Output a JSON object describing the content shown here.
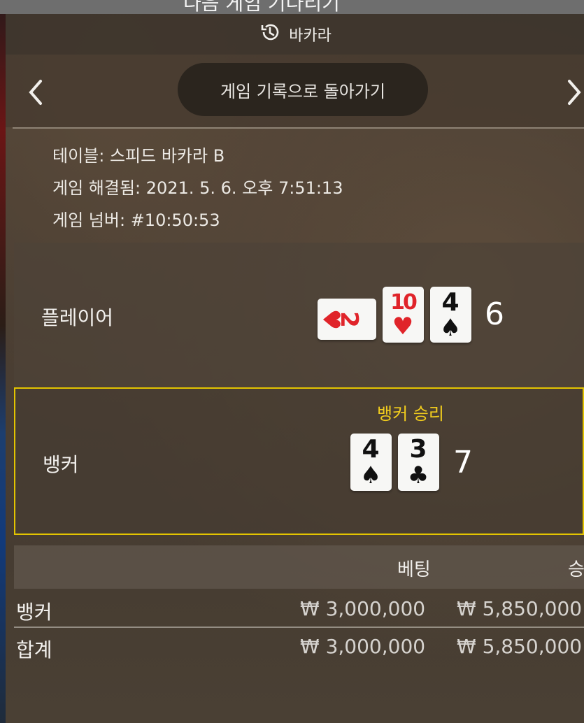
{
  "top_banner": {
    "text": "다음 게임 기다리기"
  },
  "header": {
    "title": "바카라",
    "icon": "history-icon"
  },
  "nav": {
    "back_label": "게임 기록으로 돌아가기",
    "prev_icon": "chevron-left-icon",
    "next_icon": "chevron-right-icon"
  },
  "info": {
    "table_label": "테이블:",
    "table_value": "스피드 바카라 B",
    "resolved_label": "게임 해결됨:",
    "resolved_value": "2021. 5. 6. 오후 7:51:13",
    "number_label": "게임 넘버:",
    "number_value": "#10:50:53"
  },
  "player": {
    "label": "플레이어",
    "cards": [
      {
        "rank": "2",
        "suit": "♥",
        "color": "#e0242a",
        "orientation": "sideways"
      },
      {
        "rank": "10",
        "suit": "♥",
        "color": "#e0242a",
        "orientation": "upright"
      },
      {
        "rank": "4",
        "suit": "♠",
        "color": "#111111",
        "orientation": "upright"
      }
    ],
    "score": "6"
  },
  "banker": {
    "label": "뱅커",
    "winner_text": "뱅커 승리",
    "winner_color": "#f2cd1d",
    "cards": [
      {
        "rank": "4",
        "suit": "♠",
        "color": "#111111",
        "orientation": "upright"
      },
      {
        "rank": "3",
        "suit": "♣",
        "color": "#111111",
        "orientation": "upright"
      }
    ],
    "score": "7"
  },
  "bets": {
    "headers": {
      "bet": "베팅",
      "win": "승"
    },
    "rows": [
      {
        "name": "뱅커",
        "bet": "₩ 3,000,000",
        "win": "₩ 5,850,000"
      },
      {
        "name": "합계",
        "bet": "₩ 3,000,000",
        "win": "₩ 5,850,000"
      }
    ]
  }
}
